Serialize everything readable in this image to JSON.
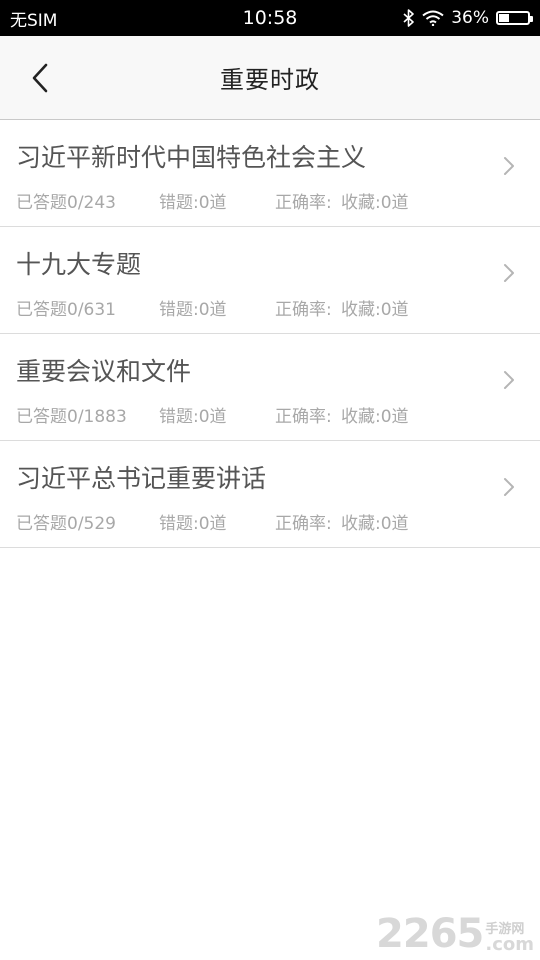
{
  "status_bar": {
    "carrier": "无SIM",
    "time": "10:58",
    "battery_text": "36%",
    "battery_level": 0.36
  },
  "nav": {
    "title": "重要时政"
  },
  "list": [
    {
      "title": "习近平新时代中国特色社会主义",
      "answered": "已答题0/243",
      "wrong": "错题:0道",
      "accuracy": "正确率:",
      "favorites": "收藏:0道"
    },
    {
      "title": "十九大专题",
      "answered": "已答题0/631",
      "wrong": "错题:0道",
      "accuracy": "正确率:",
      "favorites": "收藏:0道"
    },
    {
      "title": "重要会议和文件",
      "answered": "已答题0/1883",
      "wrong": "错题:0道",
      "accuracy": "正确率:",
      "favorites": "收藏:0道"
    },
    {
      "title": "习近平总书记重要讲话",
      "answered": "已答题0/529",
      "wrong": "错题:0道",
      "accuracy": "正确率:",
      "favorites": "收藏:0道"
    }
  ],
  "watermark": {
    "number": "2265",
    "cn": "手游网",
    "com": ".com"
  },
  "colors": {
    "status_bar_bg": "#000000",
    "nav_bg": "#f8f8f8",
    "title_text": "#555555",
    "stat_text": "#a8a8a8",
    "divider": "#dcdcdc"
  },
  "icons": {
    "back": "chevron-left-icon",
    "row_arrow": "chevron-right-icon",
    "bluetooth": "bluetooth-icon",
    "wifi": "wifi-icon",
    "battery": "battery-icon"
  }
}
